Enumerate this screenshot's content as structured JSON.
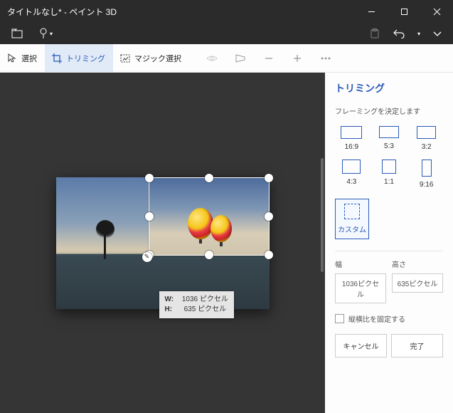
{
  "title": "タイトルなし* - ペイント 3D",
  "toolbar": {
    "select": "選択",
    "crop": "トリミング",
    "magic": "マジック選択"
  },
  "panel": {
    "title": "トリミング",
    "framing": "フレーミングを決定します",
    "ratios": {
      "r169": "16:9",
      "r53": "5:3",
      "r32": "3:2",
      "r43": "4:3",
      "r11": "1:1",
      "r916": "9:16",
      "custom": "カスタム"
    },
    "width_label": "幅",
    "height_label": "高さ",
    "width_value": "1036ピクセル",
    "height_value": "635ピクセル",
    "lock_aspect": "縦横比を固定する",
    "cancel": "キャンセル",
    "done": "完了"
  },
  "tooltip": {
    "w_label": "W:",
    "h_label": "H:",
    "w_value": "1036 ピクセル",
    "h_value": "635 ピクセル"
  }
}
